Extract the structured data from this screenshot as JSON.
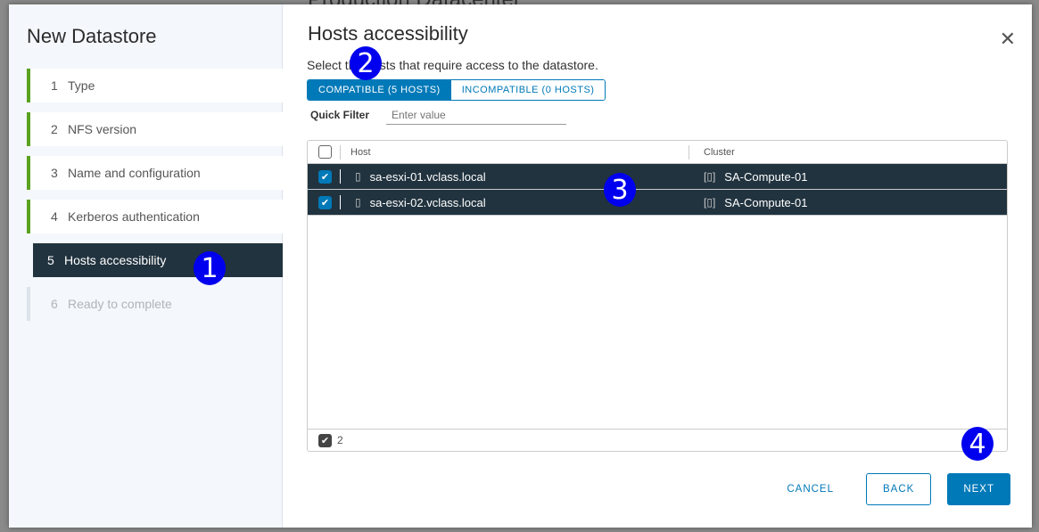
{
  "background": {
    "title": "Production Datacenter"
  },
  "wizard": {
    "title": "New Datastore",
    "steps": [
      {
        "num": "1",
        "label": "Type"
      },
      {
        "num": "2",
        "label": "NFS version"
      },
      {
        "num": "3",
        "label": "Name and configuration"
      },
      {
        "num": "4",
        "label": "Kerberos authentication"
      },
      {
        "num": "5",
        "label": "Hosts accessibility"
      },
      {
        "num": "6",
        "label": "Ready to complete"
      }
    ]
  },
  "page": {
    "title": "Hosts accessibility",
    "description": "Select the hosts that require access to the datastore.",
    "tabs": {
      "compatible": "COMPATIBLE (5 HOSTS)",
      "incompatible": "INCOMPATIBLE (0 HOSTS)"
    },
    "filter": {
      "label": "Quick Filter",
      "placeholder": "Enter value"
    },
    "grid": {
      "headers": {
        "host": "Host",
        "cluster": "Cluster"
      },
      "rows": [
        {
          "host": "sa-esxi-01.vclass.local",
          "cluster": "SA-Compute-01",
          "checked": true
        },
        {
          "host": "sa-esxi-02.vclass.local",
          "cluster": "SA-Compute-01",
          "checked": true
        }
      ],
      "selected_count": "2"
    },
    "buttons": {
      "cancel": "CANCEL",
      "back": "BACK",
      "next": "NEXT"
    }
  },
  "annotations": [
    "1",
    "2",
    "3",
    "4"
  ],
  "colors": {
    "accent": "#0079b8",
    "selected_row": "#21333f",
    "progress": "#5aa220"
  }
}
